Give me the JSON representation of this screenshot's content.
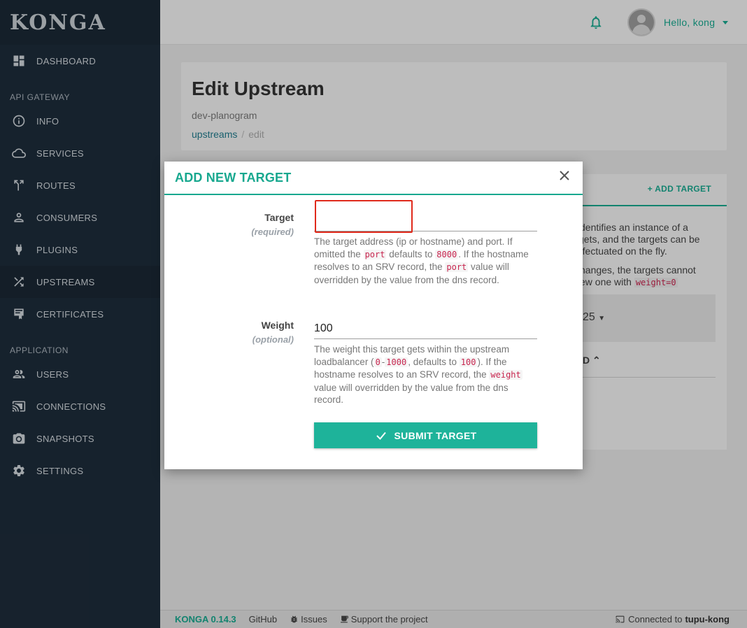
{
  "sidebar": {
    "logo": "KONGA",
    "items_top": [
      {
        "label": "DASHBOARD",
        "icon": "dashboard-icon"
      }
    ],
    "section_api": "API GATEWAY",
    "items_api": [
      {
        "label": "INFO",
        "icon": "info-icon"
      },
      {
        "label": "SERVICES",
        "icon": "cloud-icon"
      },
      {
        "label": "ROUTES",
        "icon": "routes-icon"
      },
      {
        "label": "CONSUMERS",
        "icon": "person-icon"
      },
      {
        "label": "PLUGINS",
        "icon": "plug-icon"
      },
      {
        "label": "UPSTREAMS",
        "icon": "shuffle-icon"
      },
      {
        "label": "CERTIFICATES",
        "icon": "certificate-icon"
      }
    ],
    "section_app": "APPLICATION",
    "items_app": [
      {
        "label": "USERS",
        "icon": "people-icon"
      },
      {
        "label": "CONNECTIONS",
        "icon": "cast-icon"
      },
      {
        "label": "SNAPSHOTS",
        "icon": "camera-icon"
      },
      {
        "label": "SETTINGS",
        "icon": "gear-icon"
      }
    ],
    "active": "UPSTREAMS"
  },
  "topbar": {
    "greeting": "Hello, kong",
    "accent_color": "#18a88f"
  },
  "page": {
    "title": "Edit Upstream",
    "subtitle": "dev-planogram",
    "breadcrumb_link": "upstreams",
    "breadcrumb_sep": "/",
    "breadcrumb_current": "edit"
  },
  "panel": {
    "add_target": "ADD TARGET",
    "text1": "dentifies an instance of a",
    "text2": "gets, and the targets can be",
    "text3": "ffectuated on the fly.",
    "text4": "hanges, the targets cannot",
    "text5": "ew one with",
    "code": "weight=0",
    "select_value": "25",
    "partial_label": "D"
  },
  "modal": {
    "title": "ADD NEW TARGET",
    "target": {
      "label": "Target",
      "sub": "(required)",
      "value": "",
      "help_1": "The target address (ip or hostname) and port. If omitted the",
      "code_port": "port",
      "help_2": "defaults to",
      "code_8000": "8000",
      "help_3": ". If the hostname resolves to an SRV record, the",
      "code_port2": "port",
      "help_4": "value will overridden by the value from the dns record."
    },
    "weight": {
      "label": "Weight",
      "sub": "(optional)",
      "value": "100",
      "help_1": "The weight this target gets within the upstream loadbalancer (",
      "code_0": "0",
      "help_dash": "-",
      "code_1000": "1000",
      "help_2": ", defaults to",
      "code_100": "100",
      "help_3": "). If the hostname resolves to an SRV record, the",
      "code_weight": "weight",
      "help_4": "value will overridden by the value from the dns record."
    },
    "submit_label": "SUBMIT TARGET"
  },
  "footer": {
    "brand": "KONGA 0.14.3",
    "github": "GitHub",
    "issues": "Issues",
    "support": "Support the project",
    "connected_prefix": "Connected to",
    "connection": "tupu-kong"
  }
}
